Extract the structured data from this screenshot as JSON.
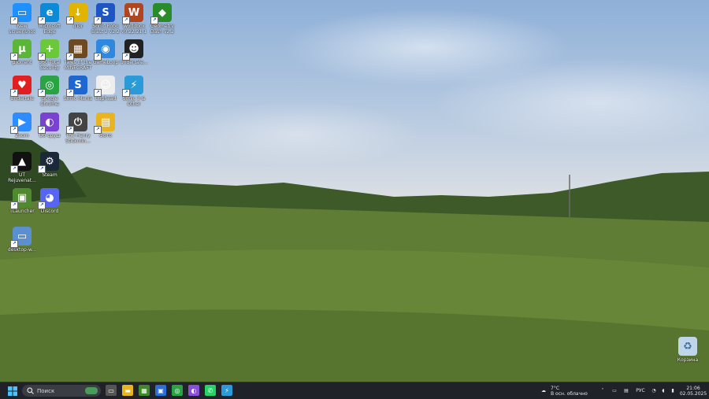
{
  "desktop_icons": [
    {
      "label": "New screenshot",
      "color": "#1e90ff",
      "glyph": "▭"
    },
    {
      "label": "Microsoft Edge",
      "color": "#0c8ad8",
      "glyph": "e"
    },
    {
      "label": "uTor",
      "color": "#e0b400",
      "glyph": "↓"
    },
    {
      "label": "Sonic Robo Blast 2 v2.2",
      "color": "#1d55c4",
      "glyph": "S"
    },
    {
      "label": "Worldbox v0.22.21.1",
      "color": "#b0451f",
      "glyph": "W"
    },
    {
      "label": "Geometry Dash v2.2",
      "color": "#2a8b2a",
      "glyph": "◆"
    },
    {
      "label": "µTorrent",
      "color": "#5bb539",
      "glyph": "µ"
    },
    {
      "label": "360 Total Security",
      "color": "#6bc83a",
      "glyph": "+"
    },
    {
      "label": "Tales of the MINECRAFT",
      "color": "#6e4a22",
      "glyph": "▦"
    },
    {
      "label": "GameLoop",
      "color": "#2f88e0",
      "glyph": "◉"
    },
    {
      "label": "Undertale...",
      "color": "#222",
      "glyph": "☻"
    },
    {
      "label": "Undertale",
      "color": "#e02020",
      "glyph": "♥"
    },
    {
      "label": "Google Chrome",
      "color": "#2aa344",
      "glyph": "◎"
    },
    {
      "label": "Sonic Mania",
      "color": "#1e66d0",
      "glyph": "S"
    },
    {
      "label": "Cuphead",
      "color": "#eee",
      "glyph": "☺"
    },
    {
      "label": "Sonic 3 & Other",
      "color": "#2a9ad8",
      "glyph": "⚡"
    },
    {
      "label": "Zoom",
      "color": "#2d8cff",
      "glyph": "▶"
    },
    {
      "label": "Об-сруш",
      "color": "#7a42d0",
      "glyph": "◐"
    },
    {
      "label": "The Henry Stickmin...",
      "color": "#444",
      "glyph": "⏻"
    },
    {
      "label": "Фото",
      "color": "#e8b420",
      "glyph": "▤"
    },
    {
      "label": "UT Rejuvenat...",
      "color": "#111",
      "glyph": "▲"
    },
    {
      "label": "Steam",
      "color": "#1b2838",
      "glyph": "⚙"
    },
    {
      "label": "TLauncher",
      "color": "#4f8a2e",
      "glyph": "▣"
    },
    {
      "label": "Discord",
      "color": "#5865f2",
      "glyph": "◕"
    },
    {
      "label": "desktop-w...",
      "color": "#5a8fd0",
      "glyph": "▭"
    }
  ],
  "recycle_bin": {
    "label": "Корзина"
  },
  "taskbar": {
    "search_placeholder": "Поиск",
    "pinned": [
      {
        "name": "task-view",
        "color": "#555",
        "glyph": "▭"
      },
      {
        "name": "file-explorer",
        "color": "#e8b420",
        "glyph": "▬"
      },
      {
        "name": "minecraft",
        "color": "#3e8a2a",
        "glyph": "▦"
      },
      {
        "name": "microsoft-store",
        "color": "#2a6fd6",
        "glyph": "▣"
      },
      {
        "name": "google-chrome",
        "color": "#2aa344",
        "glyph": "◎"
      },
      {
        "name": "copilot",
        "color": "#8a4fd8",
        "glyph": "◐"
      },
      {
        "name": "whatsapp",
        "color": "#25d366",
        "glyph": "✆"
      },
      {
        "name": "sonic",
        "color": "#2a9ad8",
        "glyph": "⚡"
      }
    ],
    "weather_temp": "7°C",
    "weather_desc": "В осн. облачно",
    "language": "РУС",
    "time": "21:06",
    "date": "02.05.2025"
  }
}
